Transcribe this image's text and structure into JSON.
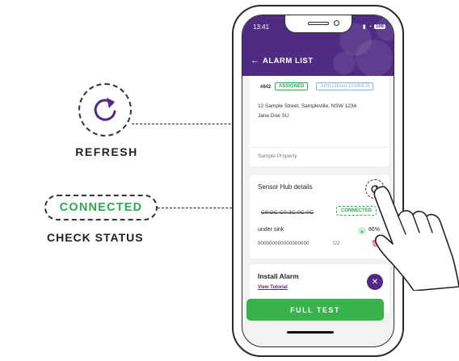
{
  "annotations": {
    "refresh_label": "REFRESH",
    "connected_label": "CONNECTED",
    "check_status_label": "CHECK STATUS",
    "refresh_icon": "refresh-icon"
  },
  "status_bar": {
    "time": "13:41",
    "battery": "100"
  },
  "header": {
    "title": "ALARM LIST",
    "back_icon": "back-arrow-icon",
    "color": "#4f2b83"
  },
  "job_card": {
    "job_number": "#842",
    "status_tag": "ASSIGNED",
    "assignee_tag": "John Citizen 12345678",
    "address": "12 Sample Street, Sampleville, NSW 1234",
    "contact": "Jane Doe SU",
    "property": "Sample Property"
  },
  "sensor_hub": {
    "title": "Sensor Hub details",
    "mac": "C8:DC:C0:3C:0C:0C",
    "status": "CONNECTED",
    "location": "under sink",
    "signal_percent": "86%",
    "serial": "000000000000000000",
    "code": "I22",
    "status_color": "#2eaa4f"
  },
  "install_card": {
    "title": "Install Alarm",
    "tutorial_link": "View Tutorial"
  },
  "footer": {
    "full_test_label": "FULL TEST",
    "button_color": "#38b24a"
  }
}
